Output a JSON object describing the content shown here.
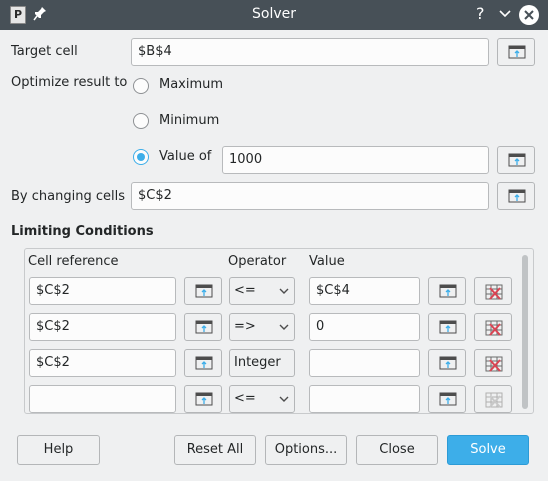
{
  "window": {
    "title": "Solver",
    "app_icon_letter": "P",
    "help_glyph": "?"
  },
  "target_cell": {
    "label": "Target cell",
    "value": "$B$4"
  },
  "optimize": {
    "label": "Optimize result to",
    "options": [
      {
        "label": "Maximum",
        "checked": false
      },
      {
        "label": "Minimum",
        "checked": false
      },
      {
        "label": "Value of",
        "checked": true
      }
    ],
    "value_of": "1000"
  },
  "changing_cells": {
    "label": "By changing cells",
    "value": "$C$2"
  },
  "limiting_conditions": {
    "title": "Limiting Conditions",
    "headers": {
      "cell_reference": "Cell reference",
      "operator": "Operator",
      "value": "Value"
    },
    "rows": [
      {
        "cell": "$C$2",
        "operator": "<=",
        "value": "$C$4"
      },
      {
        "cell": "$C$2",
        "operator": "=>",
        "value": "0"
      },
      {
        "cell": "$C$2",
        "operator": "Integer",
        "value": ""
      },
      {
        "cell": "",
        "operator": "<=",
        "value": ""
      }
    ]
  },
  "buttons": {
    "help": "Help",
    "reset_all": "Reset All",
    "options": "Options...",
    "close": "Close",
    "solve": "Solve"
  },
  "colors": {
    "accent": "#3daee9",
    "titlebar": "#475057",
    "delete_icon": "#da4453"
  }
}
